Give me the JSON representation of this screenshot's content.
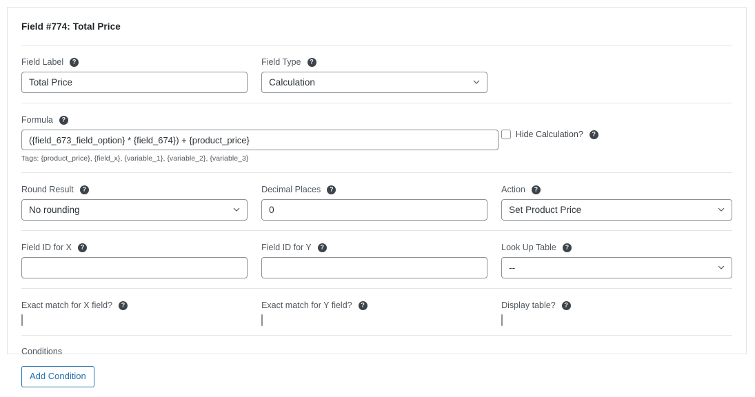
{
  "panel": {
    "title": "Field #774: Total Price"
  },
  "icons": {
    "help": "help-icon",
    "chevron_down": "chevron-down-icon"
  },
  "colors": {
    "accent": "#2271b1",
    "panel_border": "#e2e4e7",
    "divider": "#e5e5e5",
    "input_border": "#8c8f94",
    "label_text": "#50575e",
    "title_text": "#1d2327"
  },
  "fields": {
    "field_label": {
      "label": "Field Label",
      "value": "Total Price",
      "help": "?"
    },
    "field_type": {
      "label": "Field Type",
      "value": "Calculation",
      "help": "?"
    },
    "formula": {
      "label": "Formula",
      "value": "({field_673_field_option} * {field_674}) + {product_price}",
      "tags": "Tags: {product_price}, {field_x}, {variable_1}, {variable_2}, {variable_3}",
      "help": "?"
    },
    "hide_calculation": {
      "label": "Hide Calculation?",
      "checked": false,
      "help": "?"
    },
    "round_result": {
      "label": "Round Result",
      "value": "No rounding",
      "help": "?"
    },
    "decimal_places": {
      "label": "Decimal Places",
      "value": "0",
      "help": "?"
    },
    "action": {
      "label": "Action",
      "value": "Set Product Price",
      "help": "?"
    },
    "field_id_x": {
      "label": "Field ID for X",
      "value": "",
      "help": "?"
    },
    "field_id_y": {
      "label": "Field ID for Y",
      "value": "",
      "help": "?"
    },
    "look_up_table": {
      "label": "Look Up Table",
      "value": "--",
      "help": "?"
    },
    "exact_match_x": {
      "label": "Exact match for X field?",
      "checked": false,
      "help": "?"
    },
    "exact_match_y": {
      "label": "Exact match for Y field?",
      "checked": false,
      "help": "?"
    },
    "display_table": {
      "label": "Display table?",
      "checked": false,
      "help": "?"
    }
  },
  "conditions": {
    "label": "Conditions",
    "add_button": "Add Condition"
  }
}
